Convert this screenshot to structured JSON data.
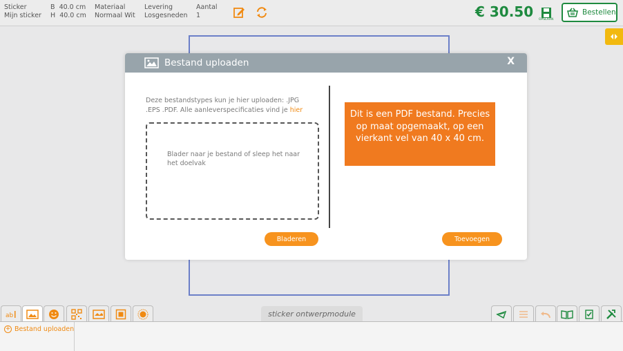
{
  "topbar": {
    "product_label": "Sticker",
    "product_value": "Mijn sticker",
    "width_label": "B",
    "width_value": "40.0 cm",
    "height_label": "H",
    "height_value": "40.0 cm",
    "material_label": "Materiaal",
    "material_value": "Normaal Wit",
    "delivery_label": "Levering",
    "delivery_value": "Losgesneden",
    "quantity_label": "Aantal",
    "quantity_value": "1",
    "price": "€ 30.50",
    "save_label": "OPSLAAN",
    "order_label": "Bestellen",
    "accent_color": "#f08a12",
    "price_color": "#1e8a3f"
  },
  "dialog": {
    "title": "Bestand uploaden",
    "close": "X",
    "hint": "Deze bestandstypes kun je hier uploaden: .JPG .EPS .PDF. Alle aanleverspecificaties vind je ",
    "hint_link": "hier",
    "drop_text": "Blader naar je bestand of sleep het naar het doelvak",
    "pdf_info": "Dit is een PDF bestand. Precies op maat opgemaakt, op een vierkant vel van 40 x 40 cm.",
    "browse_label": "Bladeren",
    "add_label": "Toevoegen"
  },
  "bottom": {
    "module_label": "sticker ontwerpmodule",
    "upload_link": "Bestand uploaden"
  }
}
